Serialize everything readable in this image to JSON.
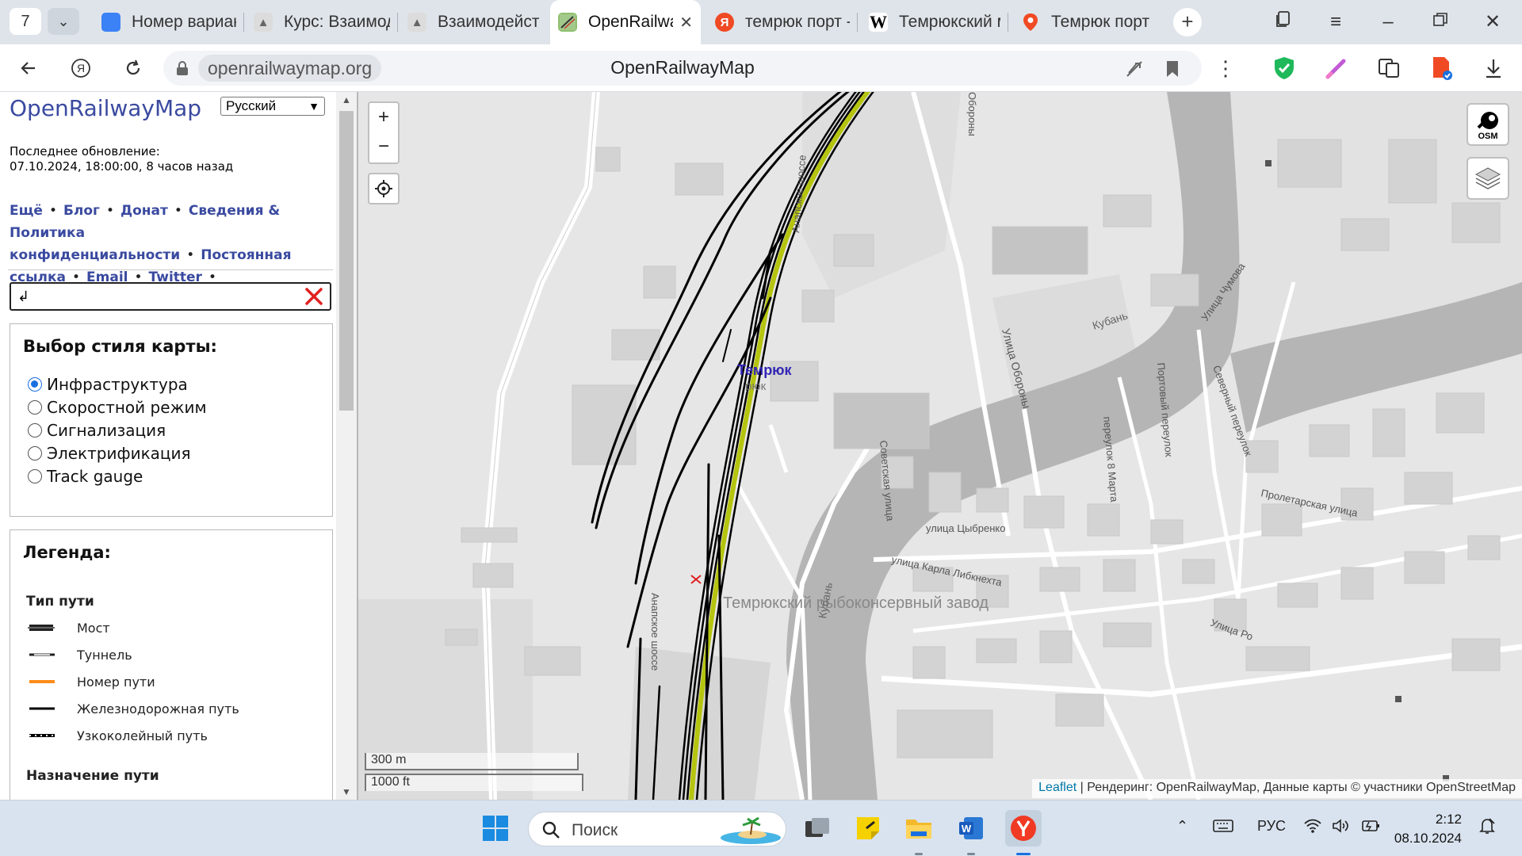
{
  "browser": {
    "tab_count": "7",
    "tabs": [
      {
        "label": "Номер вариант",
        "favicon": "blue-square-icon",
        "color": "#3b82f6"
      },
      {
        "label": "Курс: Взаимод",
        "favicon": "moodle-hat-icon",
        "color": "#777777"
      },
      {
        "label": "Взаимодействи",
        "favicon": "moodle-hat-icon",
        "color": "#777777"
      },
      {
        "label": "OpenRailwa",
        "favicon": "openrailwaymap-icon",
        "color": "#4a9a4a",
        "active": true
      },
      {
        "label": "темрюк порт -",
        "favicon": "yandex-icon",
        "color": "#f04a24"
      },
      {
        "label": "Темрюкский м",
        "favicon": "wikipedia-icon",
        "color": "#000000"
      },
      {
        "label": "Темрюк порт",
        "favicon": "maps-pin-icon",
        "color": "#f04a24"
      }
    ],
    "url_domain": "openrailwaymap.org",
    "page_title": "OpenRailwayMap"
  },
  "sidebar": {
    "title": "OpenRailwayMap",
    "language": "Русский",
    "update_label": "Последнее обновление:",
    "update_value": "07.10.2024, 18:00:00, 8 часов назад",
    "links": [
      "Ещё",
      "Блог",
      "Донат",
      "Сведения & Политика конфиденциальности",
      "Постоянная ссылка",
      "Email",
      "Twitter"
    ],
    "search_value": "↲",
    "style_heading": "Выбор стиля карты:",
    "styles": [
      {
        "label": "Инфраструктура",
        "checked": true
      },
      {
        "label": "Скоростной режим",
        "checked": false
      },
      {
        "label": "Сигнализация",
        "checked": false
      },
      {
        "label": "Электрификация",
        "checked": false
      },
      {
        "label": "Track gauge",
        "checked": false
      }
    ],
    "legend_heading": "Легенда:",
    "legend_track_type": "Тип пути",
    "legend_items": [
      {
        "label": "Мост",
        "symbol": "bridge"
      },
      {
        "label": "Туннель",
        "symbol": "tunnel"
      },
      {
        "label": "Номер пути",
        "symbol": "track-number"
      },
      {
        "label": "Железнодорожная путь",
        "symbol": "railway"
      },
      {
        "label": "Узкоколейный путь",
        "symbol": "narrow-gauge"
      }
    ],
    "legend_track_usage": "Назначение пути"
  },
  "map": {
    "labels": {
      "city": "Темрюк",
      "city_under": "рюк",
      "river": "Кубань",
      "river2": "Кубань",
      "anapa_top": "Анапское шоссе",
      "anapa_bottom": "Анапское шоссе",
      "oborony": "Улица Обороны",
      "oborony_top": "Обороны",
      "sovetskaya": "Советская улица",
      "marta": "переулок 8 Марта",
      "portovy": "Портовый переулок",
      "severny": "Северный переулок",
      "chumova": "Улица Чумова",
      "proletarskaya": "Пролетарская улица",
      "tsybrenko": "улица Цыбренко",
      "liebknecht": "улица Карла Либкнехта",
      "road_ro": "Улица Ро",
      "plant": "Темрюкский рыбоконсервный завод"
    },
    "zoom_in": "+",
    "zoom_out": "−",
    "scale_metric": "300 m",
    "scale_imperial": "1000 ft",
    "attribution_link": "Leaflet",
    "attribution_text": "| Рендеринг: OpenRailwayMap, Данные карты © участники OpenStreetMap",
    "osm_label": "OSM",
    "colors": {
      "track": "#000000",
      "main_line": "#b5c40f",
      "land": "#e6e6e6",
      "water": "#b5b5b5",
      "road": "#ffffff",
      "building": "#d3d3d3"
    }
  },
  "taskbar": {
    "search_placeholder": "Поиск",
    "language": "РУС",
    "time": "2:12",
    "date": "08.10.2024"
  }
}
